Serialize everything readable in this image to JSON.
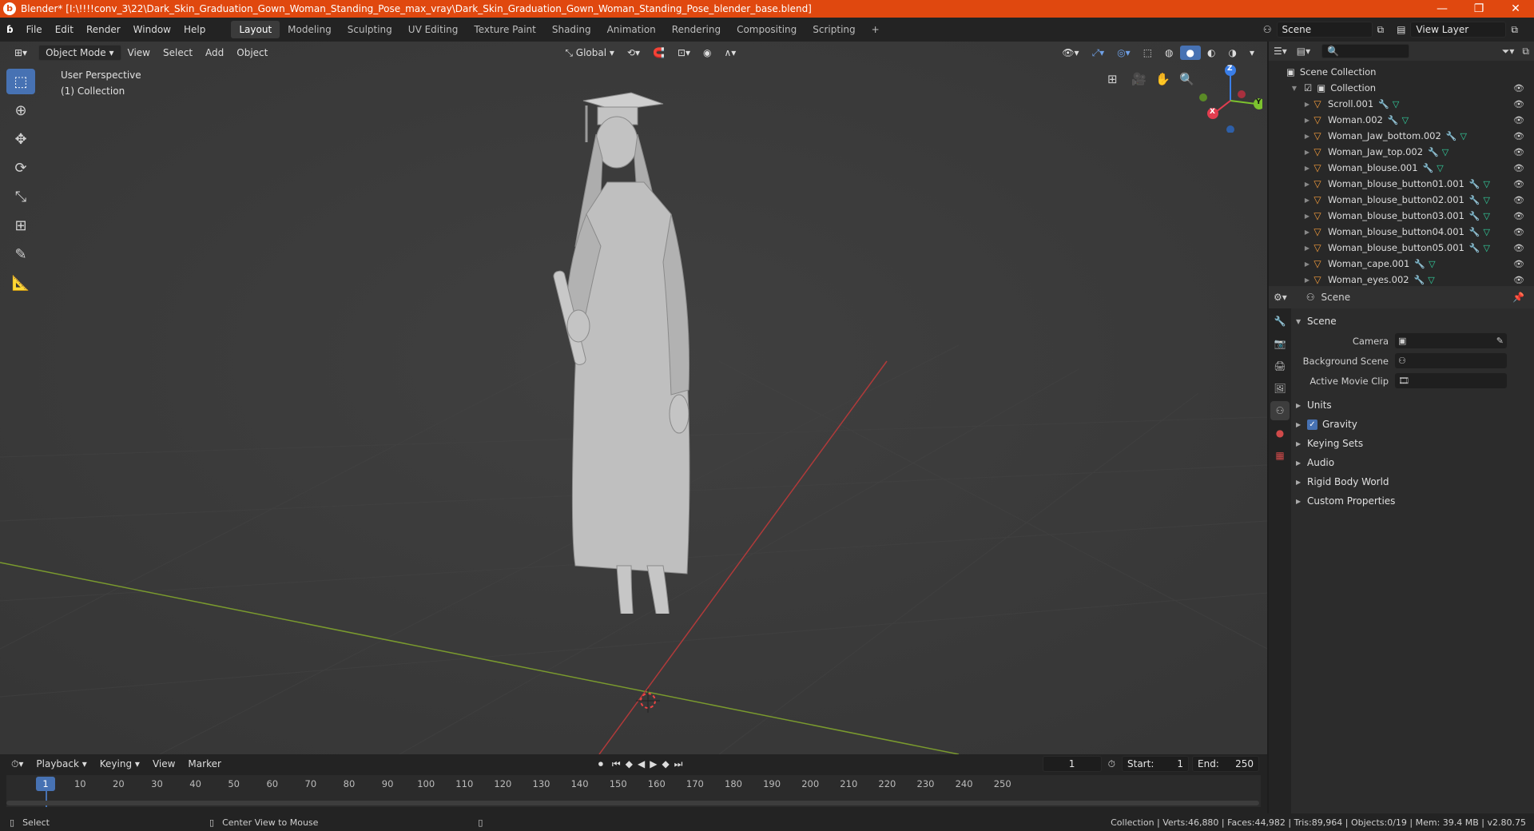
{
  "window": {
    "title": "Blender* [I:\\!!!!conv_3\\22\\Dark_Skin_Graduation_Gown_Woman_Standing_Pose_max_vray\\Dark_Skin_Graduation_Gown_Woman_Standing_Pose_blender_base.blend]"
  },
  "menu": [
    "File",
    "Edit",
    "Render",
    "Window",
    "Help"
  ],
  "workspaces": [
    "Layout",
    "Modeling",
    "Sculpting",
    "UV Editing",
    "Texture Paint",
    "Shading",
    "Animation",
    "Rendering",
    "Compositing",
    "Scripting"
  ],
  "active_workspace": "Layout",
  "scene_selector": "Scene",
  "view_layer_selector": "View Layer",
  "viewport": {
    "mode": "Object Mode",
    "menus": [
      "View",
      "Select",
      "Add",
      "Object"
    ],
    "orientation": "Global",
    "info_line1": "User Perspective",
    "info_line2": "(1) Collection",
    "gizmo": {
      "z": "Z",
      "y": "Y",
      "x": "X"
    }
  },
  "outliner": {
    "root": "Scene Collection",
    "collection": "Collection",
    "items": [
      "Scroll.001",
      "Woman.002",
      "Woman_Jaw_bottom.002",
      "Woman_Jaw_top.002",
      "Woman_blouse.001",
      "Woman_blouse_button01.001",
      "Woman_blouse_button02.001",
      "Woman_blouse_button03.001",
      "Woman_blouse_button04.001",
      "Woman_blouse_button05.001",
      "Woman_cape.001",
      "Woman_eyes.002"
    ]
  },
  "properties": {
    "context": "Scene",
    "panel": "Scene",
    "camera_label": "Camera",
    "bg_scene_label": "Background Scene",
    "movie_clip_label": "Active Movie Clip",
    "sections": [
      "Units",
      "Gravity",
      "Keying Sets",
      "Audio",
      "Rigid Body World",
      "Custom Properties"
    ]
  },
  "timeline": {
    "menus": [
      "Playback",
      "Keying",
      "View",
      "Marker"
    ],
    "current_frame": "1",
    "start_label": "Start:",
    "start": "1",
    "end_label": "End:",
    "end": "250",
    "ticks": [
      "10",
      "20",
      "30",
      "40",
      "50",
      "60",
      "70",
      "80",
      "90",
      "100",
      "110",
      "120",
      "130",
      "140",
      "150",
      "160",
      "170",
      "180",
      "190",
      "200",
      "210",
      "220",
      "230",
      "240",
      "250"
    ]
  },
  "status": {
    "left": "Select",
    "mid": "Center View to Mouse",
    "right": "Collection | Verts:46,880 | Faces:44,982 | Tris:89,964 | Objects:0/19 | Mem: 39.4 MB | v2.80.75"
  },
  "colors": {
    "accent": "#4772b3",
    "titlebar": "#e0480f",
    "mesh_icon": "#f39c3c"
  }
}
